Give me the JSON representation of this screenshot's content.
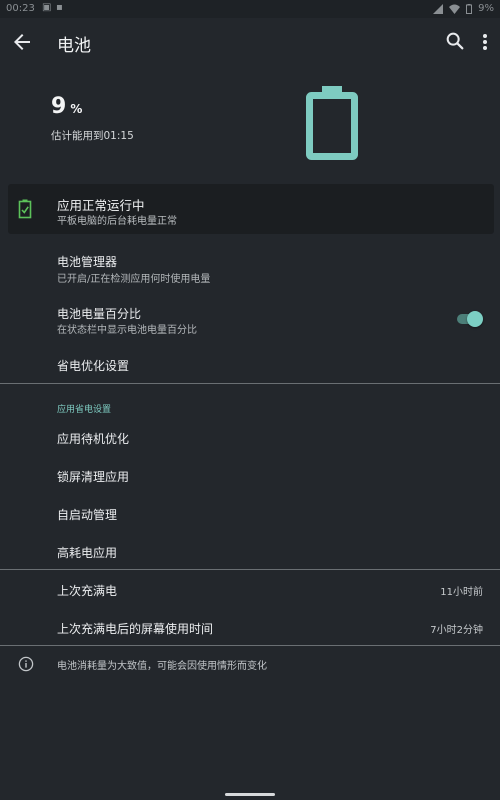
{
  "status_bar": {
    "time": "00:23",
    "icons": [
      "sim-icon",
      "image-icon",
      "signal-icon",
      "wifi-icon",
      "battery-icon"
    ],
    "battery_pct": "9%"
  },
  "app_bar": {
    "title": "电池",
    "icons": {
      "back": "arrow-left-icon",
      "search": "search-icon",
      "more": "more-vert-icon"
    }
  },
  "hero": {
    "percent": "9",
    "percent_unit": "%",
    "estimate": "估计能用到01:15",
    "battery_graphic_level_fraction": 0.09,
    "accent_color": "#7ecbc1"
  },
  "status_card": {
    "title": "应用正常运行中",
    "subtitle": "平板电脑的后台耗电量正常",
    "icon": "battery-ok-icon",
    "icon_color": "#5cc25a"
  },
  "settings": {
    "battery_manager": {
      "title": "电池管理器",
      "subtitle": "已开启/正在检测应用何时使用电量"
    },
    "battery_percentage": {
      "title": "电池电量百分比",
      "subtitle": "在状态栏中显示电池电量百分比",
      "enabled": true
    },
    "power_saving": {
      "title": "省电优化设置"
    }
  },
  "app_power_section": {
    "header": "应用省电设置",
    "items": [
      {
        "title": "应用待机优化"
      },
      {
        "title": "锁屏清理应用"
      },
      {
        "title": "自启动管理"
      },
      {
        "title": "高耗电应用"
      }
    ]
  },
  "charge_info": {
    "last_full_charge": {
      "title": "上次充满电",
      "value": "11小时前"
    },
    "screen_time": {
      "title": "上次充满电后的屏幕使用时间",
      "value": "7小时2分钟"
    }
  },
  "footer": {
    "icon": "info-icon",
    "text": "电池消耗量为大致值，可能会因使用情形而变化"
  },
  "colors": {
    "background": "#23272c",
    "card_background": "#1b1e21",
    "accent": "#7ecbc1"
  }
}
